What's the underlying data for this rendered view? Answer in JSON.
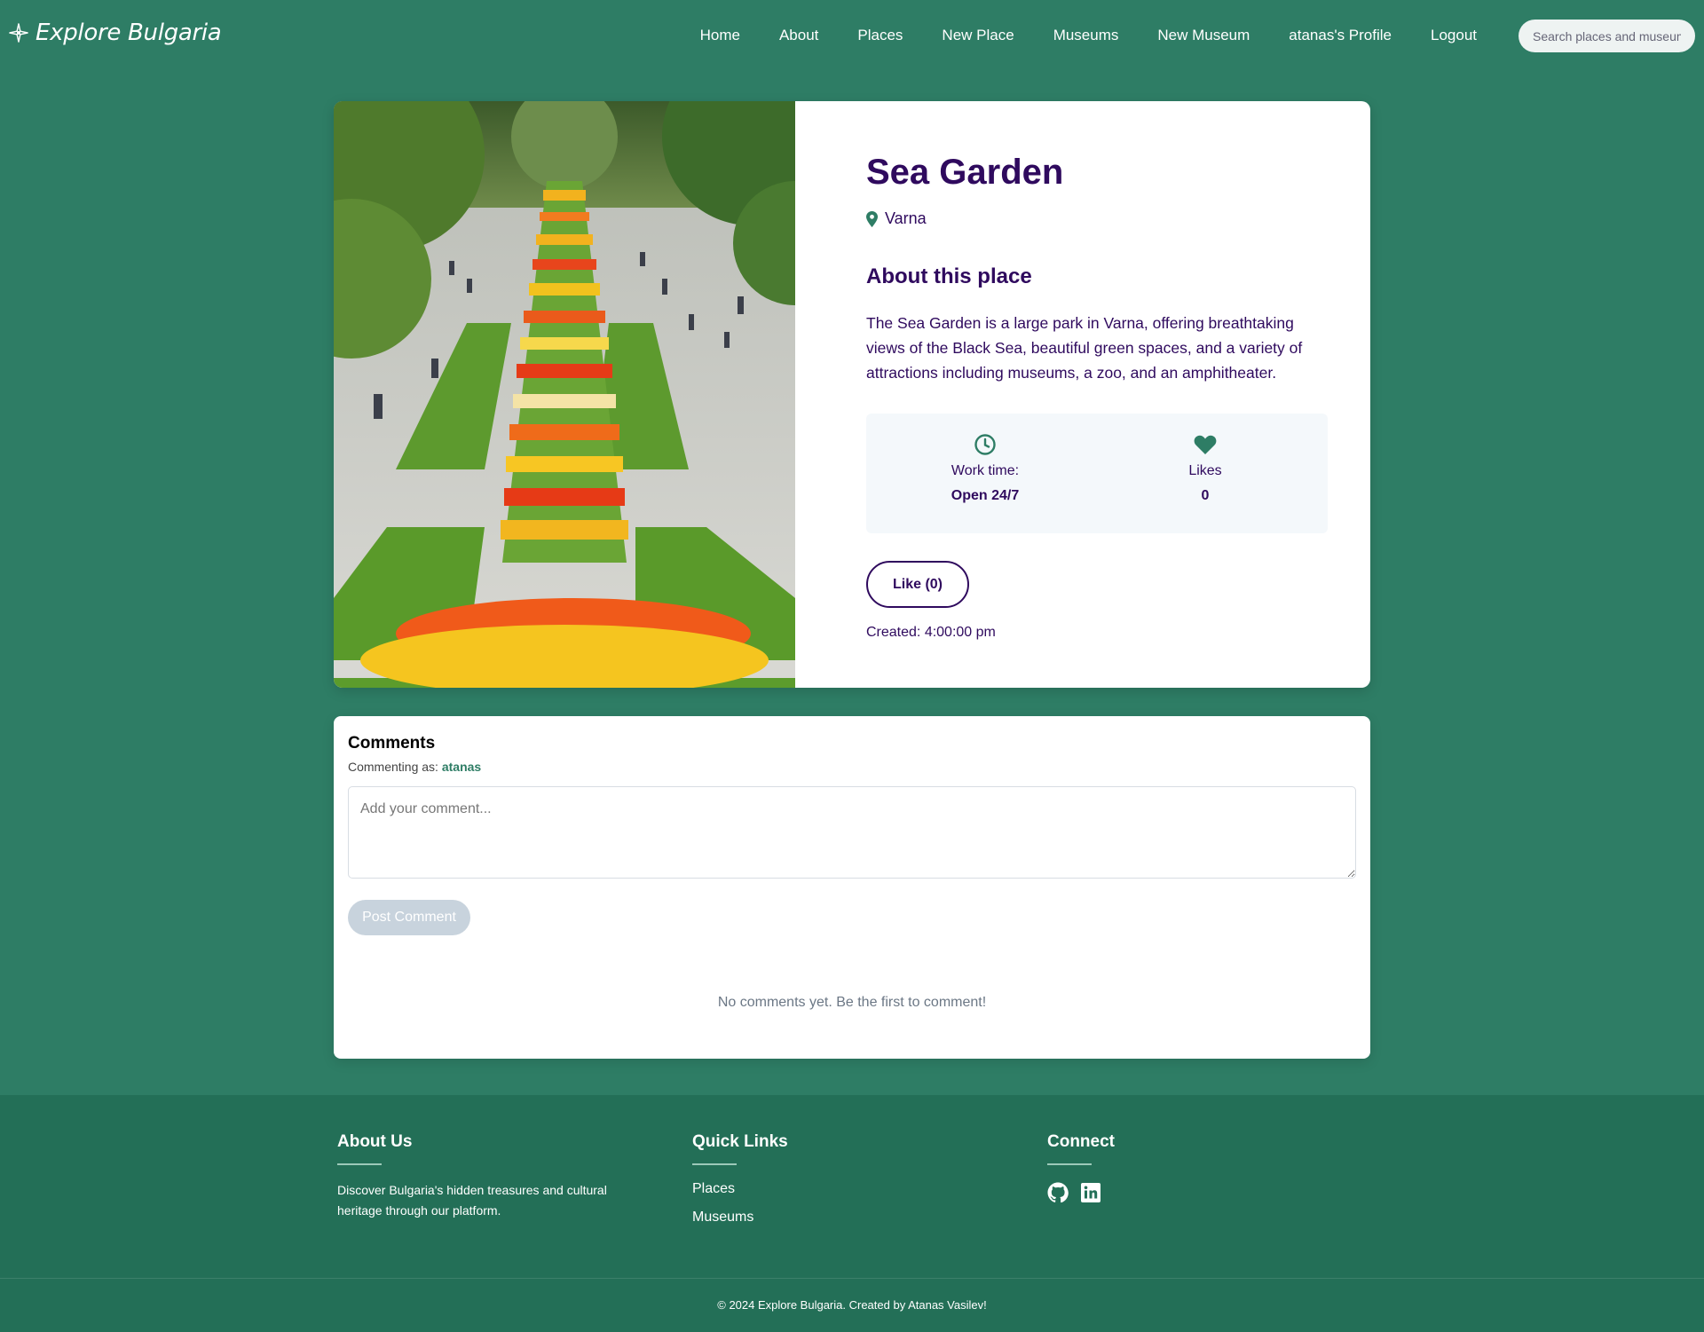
{
  "nav": {
    "brand": "Explore Bulgaria",
    "links": [
      "Home",
      "About",
      "Places",
      "New Place",
      "Museums",
      "New Museum",
      "atanas's Profile",
      "Logout"
    ],
    "search_placeholder": "Search places and museums..."
  },
  "place": {
    "title": "Sea Garden",
    "location": "Varna",
    "about_heading": "About this place",
    "description": "The Sea Garden is a large park in Varna, offering breathtaking views of the Black Sea, beautiful green spaces, and a variety of attractions including museums, a zoo, and an amphitheater.",
    "work_time_label": "Work time:",
    "work_time_value": "Open 24/7",
    "likes_label": "Likes",
    "likes_value": "0",
    "like_button": "Like (0)",
    "created": "Created: 4:00:00 pm"
  },
  "comments": {
    "title": "Comments",
    "commenting_as_label": "Commenting as:",
    "username": "atanas",
    "input_placeholder": "Add your comment...",
    "post_button": "Post Comment",
    "empty_message": "No comments yet. Be the first to comment!"
  },
  "footer": {
    "about_heading": "About Us",
    "about_text": "Discover Bulgaria's hidden treasures and cultural heritage through our platform.",
    "links_heading": "Quick Links",
    "links": [
      "Places",
      "Museums"
    ],
    "connect_heading": "Connect",
    "social_icons": [
      "github-icon",
      "linkedin-icon"
    ],
    "copyright": "© 2024 Explore Bulgaria. Created by Atanas Vasilev!"
  },
  "colors": {
    "page_bg": "#2e7d65",
    "footer_bg": "#236f57",
    "title_purple": "#2f0a5e",
    "accent_green": "#2e7d65"
  }
}
